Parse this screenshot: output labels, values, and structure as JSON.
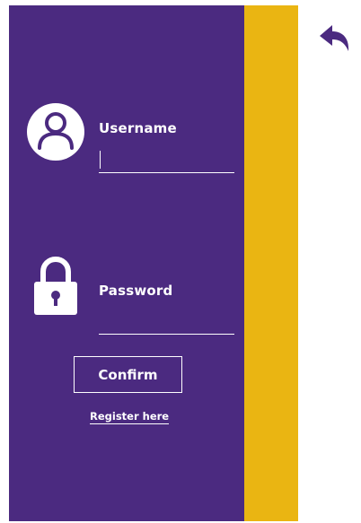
{
  "colors": {
    "panel": "#4b2a80",
    "stripe": "#eab512",
    "text": "#ffffff",
    "background": "#ffffff"
  },
  "icons": {
    "back": "back-arrow-icon",
    "user": "user-avatar-icon",
    "lock": "lock-icon"
  },
  "form": {
    "username_label": "Username",
    "username_value": "",
    "password_label": "Password",
    "password_value": "",
    "confirm_label": "Confirm",
    "register_label": "Register here"
  }
}
